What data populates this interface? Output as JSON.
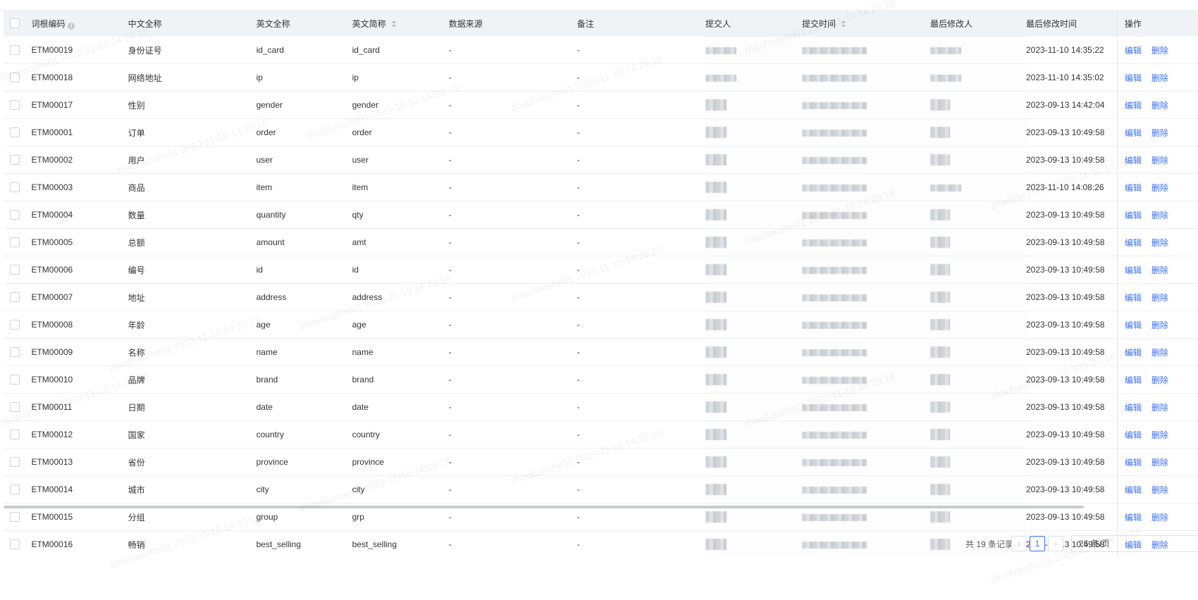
{
  "table": {
    "columns": {
      "code": "词根编码",
      "cn_name": "中文全称",
      "en_name": "英文全称",
      "en_abbr": "英文简称",
      "source": "数据来源",
      "remark": "备注",
      "submitter": "提交人",
      "submit_time": "提交时间",
      "modifier": "最后修改人",
      "modify_time": "最后修改时间",
      "ops": "操作"
    },
    "actions": {
      "edit": "编辑",
      "delete": "删除"
    },
    "rows": [
      {
        "code": "ETM00019",
        "cn": "身份证号",
        "en": "id_card",
        "abbr": "id_card",
        "source": "-",
        "remark": "-",
        "modify_time": "2023-11-10 14:35:22"
      },
      {
        "code": "ETM00018",
        "cn": "网络地址",
        "en": "ip",
        "abbr": "ip",
        "source": "-",
        "remark": "-",
        "modify_time": "2023-11-10 14:35:02"
      },
      {
        "code": "ETM00017",
        "cn": "性别",
        "en": "gender",
        "abbr": "gender",
        "source": "-",
        "remark": "-",
        "modify_time": "2023-09-13 14:42:04"
      },
      {
        "code": "ETM00001",
        "cn": "订单",
        "en": "order",
        "abbr": "order",
        "source": "-",
        "remark": "-",
        "modify_time": "2023-09-13 10:49:58"
      },
      {
        "code": "ETM00002",
        "cn": "用户",
        "en": "user",
        "abbr": "user",
        "source": "-",
        "remark": "-",
        "modify_time": "2023-09-13 10:49:58"
      },
      {
        "code": "ETM00003",
        "cn": "商品",
        "en": "item",
        "abbr": "item",
        "source": "-",
        "remark": "-",
        "modify_time": "2023-11-10 14:08:26"
      },
      {
        "code": "ETM00004",
        "cn": "数量",
        "en": "quantity",
        "abbr": "qty",
        "source": "-",
        "remark": "-",
        "modify_time": "2023-09-13 10:49:58"
      },
      {
        "code": "ETM00005",
        "cn": "总额",
        "en": "amount",
        "abbr": "amt",
        "source": "-",
        "remark": "-",
        "modify_time": "2023-09-13 10:49:58"
      },
      {
        "code": "ETM00006",
        "cn": "编号",
        "en": "id",
        "abbr": "id",
        "source": "-",
        "remark": "-",
        "modify_time": "2023-09-13 10:49:58"
      },
      {
        "code": "ETM00007",
        "cn": "地址",
        "en": "address",
        "abbr": "address",
        "source": "-",
        "remark": "-",
        "modify_time": "2023-09-13 10:49:58"
      },
      {
        "code": "ETM00008",
        "cn": "年龄",
        "en": "age",
        "abbr": "age",
        "source": "-",
        "remark": "-",
        "modify_time": "2023-09-13 10:49:58"
      },
      {
        "code": "ETM00009",
        "cn": "名称",
        "en": "name",
        "abbr": "name",
        "source": "-",
        "remark": "-",
        "modify_time": "2023-09-13 10:49:58"
      },
      {
        "code": "ETM00010",
        "cn": "品牌",
        "en": "brand",
        "abbr": "brand",
        "source": "-",
        "remark": "-",
        "modify_time": "2023-09-13 10:49:58"
      },
      {
        "code": "ETM00011",
        "cn": "日期",
        "en": "date",
        "abbr": "date",
        "source": "-",
        "remark": "-",
        "modify_time": "2023-09-13 10:49:58"
      },
      {
        "code": "ETM00012",
        "cn": "国家",
        "en": "country",
        "abbr": "country",
        "source": "-",
        "remark": "-",
        "modify_time": "2023-09-13 10:49:58"
      },
      {
        "code": "ETM00013",
        "cn": "省份",
        "en": "province",
        "abbr": "province",
        "source": "-",
        "remark": "-",
        "modify_time": "2023-09-13 10:49:58"
      },
      {
        "code": "ETM00014",
        "cn": "城市",
        "en": "city",
        "abbr": "city",
        "source": "-",
        "remark": "-",
        "modify_time": "2023-09-13 10:49:58"
      },
      {
        "code": "ETM00015",
        "cn": "分组",
        "en": "group",
        "abbr": "grp",
        "source": "-",
        "remark": "-",
        "modify_time": "2023-09-13 10:49:58"
      },
      {
        "code": "ETM00016",
        "cn": "畅销",
        "en": "best_selling",
        "abbr": "best_selling",
        "source": "-",
        "remark": "-",
        "modify_time": "2023-09-13 10:49:58"
      }
    ]
  },
  "pagination": {
    "total_text": "共 19 条记录",
    "prev_icon": "chevron-left-icon",
    "current_page": "1",
    "next_icon": "chevron-right-icon",
    "page_size": "25 条/页"
  },
  "watermark": {
    "user": "zhaohaozhe01",
    "datetime": "2023-11-10 14:29:18"
  },
  "colors": {
    "link": "#3b6ff5",
    "header_bg": "#f0f2f5"
  }
}
